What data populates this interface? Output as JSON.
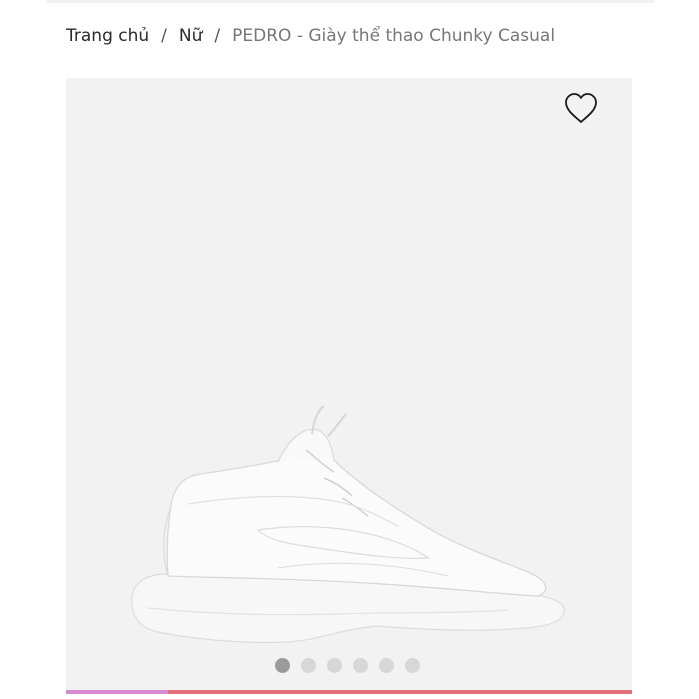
{
  "breadcrumb": {
    "home": "Trang chủ",
    "category": "Nữ",
    "separator": "/",
    "current": "PEDRO - Giày thể thao Chunky Casual"
  },
  "gallery": {
    "wishlist_icon": "heart-outline-icon",
    "image": "white-chunky-sneaker",
    "slide_count": 6,
    "active_slide": 1
  },
  "colors": {
    "background": "#f2f2f2",
    "accent_pink": "#d78bd1",
    "accent_red": "#e2707a"
  }
}
